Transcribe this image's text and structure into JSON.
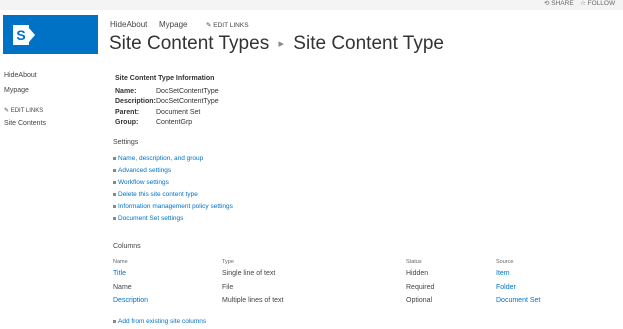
{
  "topbar": {
    "share_label": "SHARE",
    "follow_label": "FOLLOW"
  },
  "brand_color": "#0072c6",
  "topnav": {
    "items": [
      "HideAbout",
      "Mypage"
    ],
    "edit_links": "EDIT LINKS"
  },
  "page": {
    "title_parent": "Site Content Types",
    "title_current": "Site Content Type"
  },
  "leftnav": {
    "items": [
      "HideAbout",
      "Mypage"
    ],
    "edit_links": "EDIT LINKS",
    "site_contents": "Site Contents"
  },
  "info": {
    "heading": "Site Content Type Information",
    "name_label": "Name:",
    "name_value": "DocSetContentType",
    "description_label": "Description:",
    "description_value": "DocSetContentType",
    "parent_label": "Parent:",
    "parent_value": "Document Set",
    "group_label": "Group:",
    "group_value": "ContentGrp"
  },
  "settings": {
    "heading": "Settings",
    "items": [
      "Name, description, and group",
      "Advanced settings",
      "Workflow settings",
      "Delete this site content type",
      "Information management policy settings",
      "Document Set settings"
    ]
  },
  "columns": {
    "heading": "Columns",
    "headers": [
      "Name",
      "Type",
      "Status",
      "Source"
    ],
    "rows": [
      {
        "name": "Title",
        "type": "Single line of text",
        "status": "Hidden",
        "source": "Item"
      },
      {
        "name": "Name",
        "type": "File",
        "status": "Required",
        "source": "Folder"
      },
      {
        "name": "Description",
        "type": "Multiple lines of text",
        "status": "Optional",
        "source": "Document Set"
      }
    ],
    "add_link": "Add from existing site columns"
  }
}
